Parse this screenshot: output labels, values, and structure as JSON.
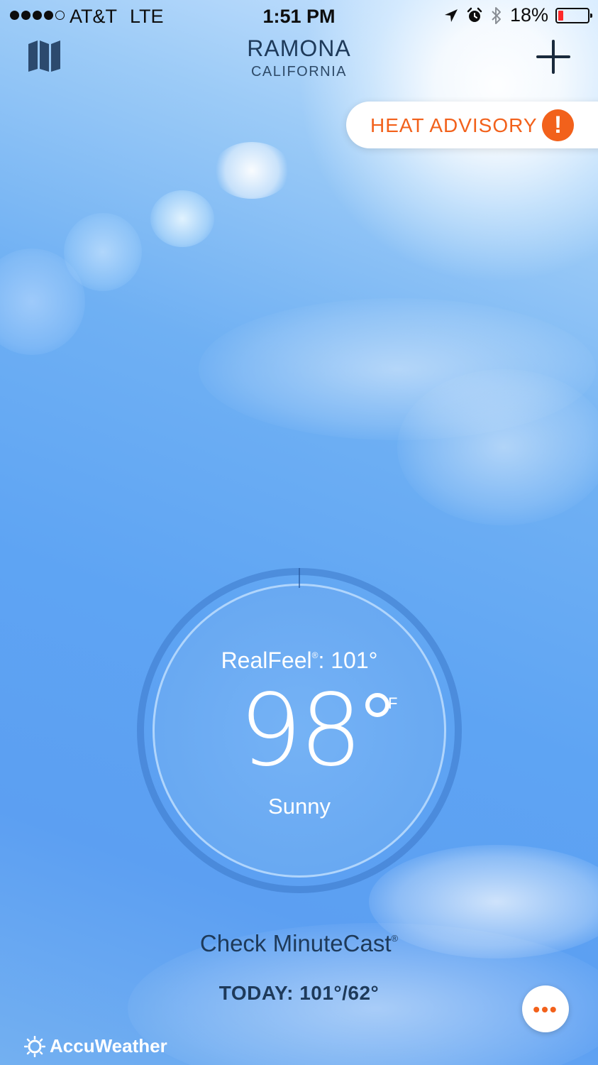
{
  "status_bar": {
    "carrier": "AT&T",
    "network": "LTE",
    "time": "1:51 PM",
    "battery": "18%",
    "battery_level": 0.18,
    "signal_bars": 4,
    "icons": [
      "location-arrow-icon",
      "alarm-icon",
      "bluetooth-icon"
    ]
  },
  "header": {
    "city": "RAMONA",
    "state": "CALIFORNIA",
    "left_icon": "map-icon",
    "right_icon": "plus-icon"
  },
  "advisory": {
    "label": "HEAT ADVISORY",
    "badge": "!",
    "color": "#f2611b"
  },
  "current": {
    "realfeel_label": "RealFeel",
    "realfeel_mark": "®",
    "realfeel_value": ": 101°",
    "temperature": "98",
    "unit": "F",
    "condition": "Sunny"
  },
  "minutecast": {
    "label": "Check MinuteCast",
    "mark": "®"
  },
  "today": {
    "label": "TODAY: 101°/62°"
  },
  "more_button": {
    "label": "•••"
  },
  "brand": {
    "name": "AccuWeather",
    "icon": "sun-logo-icon"
  },
  "colors": {
    "accent": "#f2611b",
    "text_dark": "#1e3a5a",
    "sky": "#5ea4f3"
  }
}
